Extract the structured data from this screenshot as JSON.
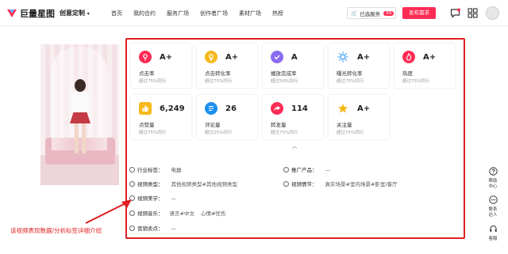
{
  "header": {
    "logo_text": "巨量星图",
    "product": "创意定制",
    "nav": [
      "首页",
      "我的合约",
      "服务广场",
      "创作者广场",
      "素材广场",
      "热榜"
    ],
    "selected_label": "已选服务",
    "selected_count": "99",
    "publish_label": "发布需求"
  },
  "metrics": [
    {
      "icon": "click-icon",
      "value": "A+",
      "label": "点击率",
      "sub": "超过75%同行",
      "color": "#fe2c55"
    },
    {
      "icon": "conversion-icon",
      "value": "A+",
      "label": "点击转化率",
      "sub": "超过75%同行",
      "color": "#f5b91a"
    },
    {
      "icon": "completion-icon",
      "value": "A",
      "label": "播放完成率",
      "sub": "超过50%同行",
      "color": "#8a6cf0"
    },
    {
      "icon": "exposure-icon",
      "value": "A+",
      "label": "曝光转化率",
      "sub": "超过75%同行",
      "color": "#1e8ff0"
    },
    {
      "icon": "heat-icon",
      "value": "A+",
      "label": "热度",
      "sub": "超过75%同行",
      "color": "#fe2c55"
    },
    {
      "icon": "like-icon",
      "value": "6,249",
      "label": "点赞量",
      "sub": "超过75%同行",
      "color": "#f5b91a"
    },
    {
      "icon": "comment-icon",
      "value": "26",
      "label": "评论量",
      "sub": "超过25%同行",
      "color": "#1e8ff0"
    },
    {
      "icon": "share-icon",
      "value": "114",
      "label": "转发量",
      "sub": "超过75%同行",
      "color": "#fe2c55"
    },
    {
      "icon": "follow-icon",
      "value": "A+",
      "label": "关注量",
      "sub": "超过75%同行",
      "color": "#f5b91a"
    }
  ],
  "details": {
    "industry_label": "行业标签：",
    "industry_value": "电器",
    "promo_label": "推广产品：",
    "promo_value": "—",
    "type_label": "视频类型：",
    "type_value": "其他视频类型#其他视频类型",
    "plot_label": "视频情节：",
    "plot_value": "真实场景#室内场景#卧室/客厅",
    "aesthetic_label": "视频美学：",
    "aesthetic_value": "—",
    "music_label": "视频音乐：",
    "music_tag1": "语言#中文",
    "music_tag2": "心情#忧伤",
    "selling_label": "营销卖点：",
    "selling_value": "—"
  },
  "annotation": "该视频表现数据/分析标签详细介绍",
  "sidebar": [
    {
      "icon": "help-icon",
      "label1": "帮助",
      "label2": "中心"
    },
    {
      "icon": "contact-icon",
      "label1": "联系",
      "label2": "达人"
    },
    {
      "icon": "service-icon",
      "label1": "客服",
      "label2": ""
    }
  ],
  "colors": {
    "brand": "#fe2c55",
    "annotation": "#e02020"
  }
}
